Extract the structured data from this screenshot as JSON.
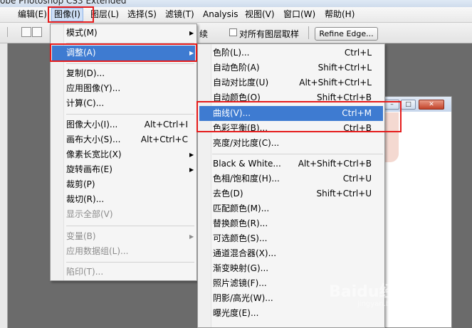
{
  "window": {
    "title": "obe Photoshop CS3 Extended"
  },
  "menubar": [
    {
      "label": "编辑(E)"
    },
    {
      "label": "图像(I)"
    },
    {
      "label": "图层(L)"
    },
    {
      "label": "选择(S)"
    },
    {
      "label": "滤镜(T)"
    },
    {
      "label": "Analysis"
    },
    {
      "label": "视图(V)"
    },
    {
      "label": "窗口(W)"
    },
    {
      "label": "帮助(H)"
    }
  ],
  "options": {
    "continuous_label": "续",
    "sample_all_layers_label": "对所有图层取样",
    "refine_edge_label": "Refine Edge..."
  },
  "image_menu": {
    "items": [
      {
        "label": "模式(M)",
        "submenu": true
      },
      {
        "label": "调整(A)",
        "submenu": true,
        "highlighted": true
      },
      {
        "label": "复制(D)..."
      },
      {
        "label": "应用图像(Y)..."
      },
      {
        "label": "计算(C)..."
      },
      {
        "label": "图像大小(I)...",
        "shortcut": "Alt+Ctrl+I"
      },
      {
        "label": "画布大小(S)...",
        "shortcut": "Alt+Ctrl+C"
      },
      {
        "label": "像素长宽比(X)",
        "submenu": true
      },
      {
        "label": "旋转画布(E)",
        "submenu": true
      },
      {
        "label": "裁剪(P)"
      },
      {
        "label": "裁切(R)..."
      },
      {
        "label": "显示全部(V)",
        "disabled": true
      },
      {
        "label": "变量(B)",
        "submenu": true,
        "disabled": true
      },
      {
        "label": "应用数据组(L)...",
        "disabled": true
      },
      {
        "label": "陷印(T)...",
        "disabled": true
      }
    ]
  },
  "adjust_menu": {
    "items": [
      {
        "label": "色阶(L)...",
        "shortcut": "Ctrl+L"
      },
      {
        "label": "自动色阶(A)",
        "shortcut": "Shift+Ctrl+L"
      },
      {
        "label": "自动对比度(U)",
        "shortcut": "Alt+Shift+Ctrl+L"
      },
      {
        "label": "自动颜色(O)",
        "shortcut": "Shift+Ctrl+B"
      },
      {
        "label": "曲线(V)...",
        "shortcut": "Ctrl+M",
        "highlighted": true
      },
      {
        "label": "色彩平衡(B)...",
        "shortcut": "Ctrl+B"
      },
      {
        "label": "亮度/对比度(C)..."
      },
      {
        "label": "Black & White...",
        "shortcut": "Alt+Shift+Ctrl+B"
      },
      {
        "label": "色相/饱和度(H)...",
        "shortcut": "Ctrl+U"
      },
      {
        "label": "去色(D)",
        "shortcut": "Shift+Ctrl+U"
      },
      {
        "label": "匹配颜色(M)..."
      },
      {
        "label": "替换颜色(R)..."
      },
      {
        "label": "可选颜色(S)..."
      },
      {
        "label": "通道混合器(X)..."
      },
      {
        "label": "渐变映射(G)..."
      },
      {
        "label": "照片滤镜(F)..."
      },
      {
        "label": "阴影/高光(W)..."
      },
      {
        "label": "曝光度(E)..."
      }
    ]
  },
  "watermark": {
    "text": "Baidu经验",
    "sub": "jingyan.baidu.com"
  },
  "colors": {
    "highlight": "#3e7bd1",
    "annotation": "#e51b1b"
  }
}
